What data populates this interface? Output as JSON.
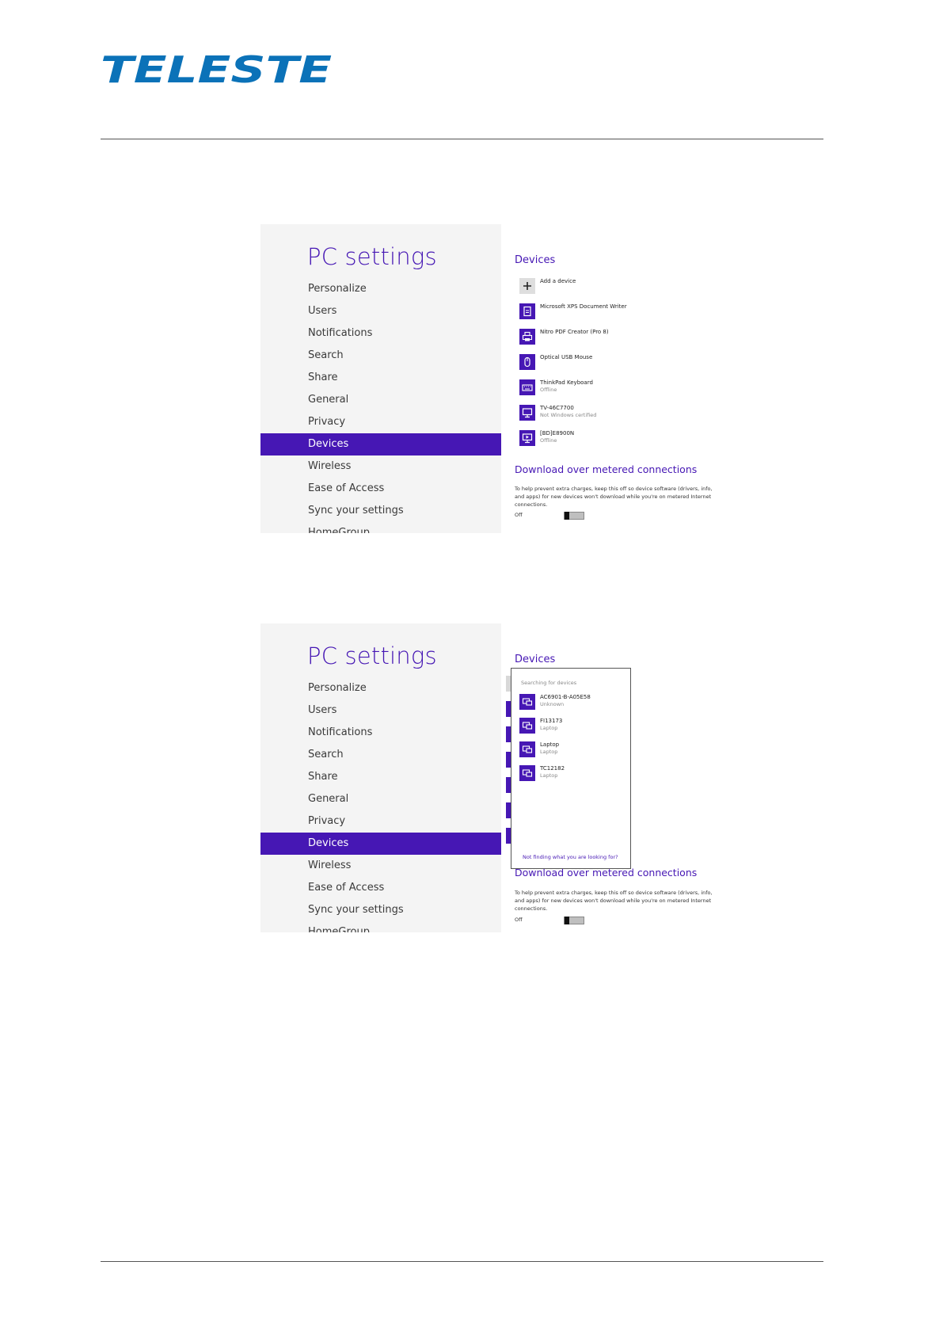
{
  "header": {
    "logo_text": "TELESTE",
    "brand_color": "#0b72b8"
  },
  "accent_color": "#4617b4",
  "screenshots": [
    {
      "title": "PC settings",
      "nav": [
        "Personalize",
        "Users",
        "Notifications",
        "Search",
        "Share",
        "General",
        "Privacy",
        "Devices",
        "Wireless",
        "Ease of Access",
        "Sync your settings",
        "HomeGroup"
      ],
      "active_nav": "Devices",
      "devices_title": "Devices",
      "devices": [
        {
          "name": "Add a device",
          "sub": "",
          "icon": "plus-icon"
        },
        {
          "name": "Microsoft XPS Document Writer",
          "sub": "",
          "icon": "document-icon"
        },
        {
          "name": "Nitro PDF Creator (Pro 8)",
          "sub": "",
          "icon": "printer-icon"
        },
        {
          "name": "Optical USB Mouse",
          "sub": "",
          "icon": "mouse-icon"
        },
        {
          "name": "ThinkPad Keyboard",
          "sub": "Offline",
          "icon": "keyboard-icon"
        },
        {
          "name": "TV-46C7700",
          "sub": "Not Windows certified",
          "icon": "monitor-icon"
        },
        {
          "name": "[BD]E8900N",
          "sub": "Offline",
          "icon": "media-player-icon"
        }
      ],
      "download_title": "Download over metered connections",
      "download_desc": "To help prevent extra charges, keep this off so device software (drivers, info, and apps) for new devices won't download while you're on metered Internet connections.",
      "toggle_label": "Off",
      "toggle_on": false
    },
    {
      "title": "PC settings",
      "nav": [
        "Personalize",
        "Users",
        "Notifications",
        "Search",
        "Share",
        "General",
        "Privacy",
        "Devices",
        "Wireless",
        "Ease of Access",
        "Sync your settings",
        "HomeGroup"
      ],
      "active_nav": "Devices",
      "devices_title": "Devices",
      "flyout": {
        "heading": "Searching for devices",
        "items": [
          {
            "name": "AC6901-B-A05E58",
            "sub": "Unknown",
            "icon": "device-icon"
          },
          {
            "name": "FI13173",
            "sub": "Laptop",
            "icon": "device-icon"
          },
          {
            "name": "Laptop",
            "sub": "Laptop",
            "icon": "device-icon"
          },
          {
            "name": "TC12182",
            "sub": "Laptop",
            "icon": "device-icon"
          }
        ],
        "link": "Not finding what you are looking for?"
      },
      "download_title": "Download over metered connections",
      "download_desc": "To help prevent extra charges, keep this off so device software (drivers, info, and apps) for new devices won't download while you're on metered Internet connections.",
      "toggle_label": "Off",
      "toggle_on": false
    }
  ]
}
